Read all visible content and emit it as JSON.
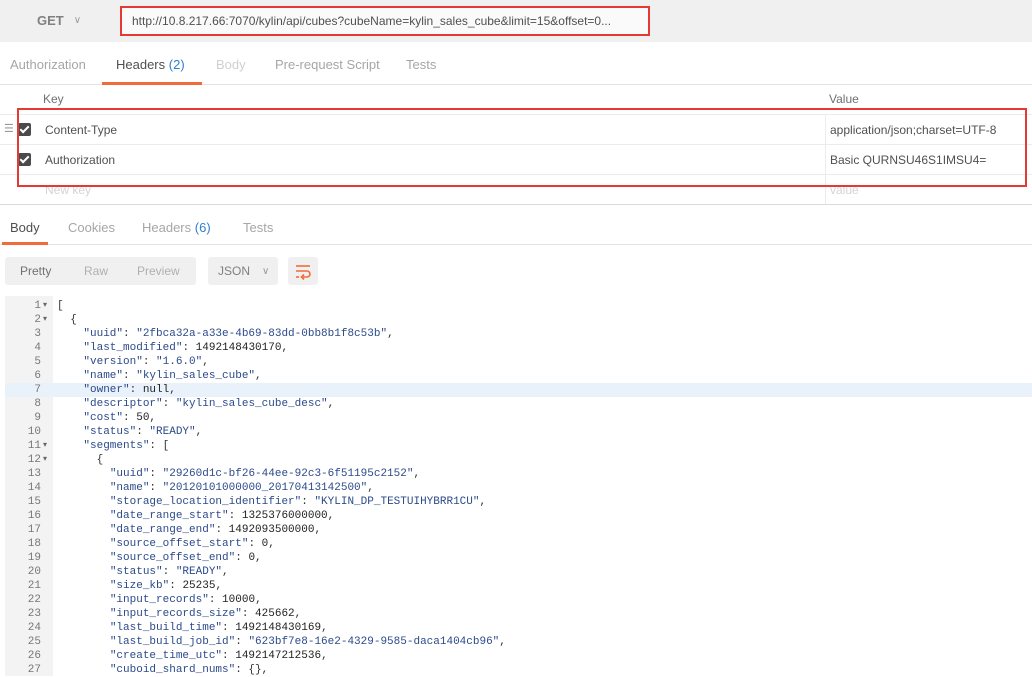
{
  "request": {
    "method": "GET",
    "url": "http://10.8.217.66:7070/kylin/api/cubes?cubeName=kylin_sales_cube&limit=15&offset=0..."
  },
  "request_tabs": [
    {
      "label": "Authorization"
    },
    {
      "label": "Headers",
      "count": "(2)"
    },
    {
      "label": "Body"
    },
    {
      "label": "Pre-request Script"
    },
    {
      "label": "Tests"
    }
  ],
  "headers_table": {
    "key_col": "Key",
    "value_col": "Value",
    "rows": [
      {
        "key": "Content-Type",
        "value": "application/json;charset=UTF-8"
      },
      {
        "key": "Authorization",
        "value": "Basic QURNSU46S1IMSU4="
      }
    ],
    "new_key_placeholder": "New key",
    "new_value_placeholder": "value"
  },
  "response_tabs": [
    {
      "label": "Body"
    },
    {
      "label": "Cookies"
    },
    {
      "label": "Headers",
      "count": "(6)"
    },
    {
      "label": "Tests"
    }
  ],
  "body_toolbar": {
    "views": [
      "Pretty",
      "Raw",
      "Preview"
    ],
    "format": "JSON",
    "wrap_icon": "wrap-lines-icon"
  },
  "code_lines": [
    {
      "n": "1",
      "fold": "▾",
      "text": "["
    },
    {
      "n": "2",
      "fold": "▾",
      "text": "  {"
    },
    {
      "n": "3",
      "fold": "",
      "text": "    \"uuid\": \"2fbca32a-a33e-4b69-83dd-0bb8b1f8c53b\","
    },
    {
      "n": "4",
      "fold": "",
      "text": "    \"last_modified\": 1492148430170,"
    },
    {
      "n": "5",
      "fold": "",
      "text": "    \"version\": \"1.6.0\","
    },
    {
      "n": "6",
      "fold": "",
      "text": "    \"name\": \"kylin_sales_cube\","
    },
    {
      "n": "7",
      "fold": "",
      "text": "    \"owner\": null,"
    },
    {
      "n": "8",
      "fold": "",
      "text": "    \"descriptor\": \"kylin_sales_cube_desc\","
    },
    {
      "n": "9",
      "fold": "",
      "text": "    \"cost\": 50,"
    },
    {
      "n": "10",
      "fold": "",
      "text": "    \"status\": \"READY\","
    },
    {
      "n": "11",
      "fold": "▾",
      "text": "    \"segments\": ["
    },
    {
      "n": "12",
      "fold": "▾",
      "text": "      {"
    },
    {
      "n": "13",
      "fold": "",
      "text": "        \"uuid\": \"29260d1c-bf26-44ee-92c3-6f51195c2152\","
    },
    {
      "n": "14",
      "fold": "",
      "text": "        \"name\": \"20120101000000_20170413142500\","
    },
    {
      "n": "15",
      "fold": "",
      "text": "        \"storage_location_identifier\": \"KYLIN_DP_TESTUIHYBRR1CU\","
    },
    {
      "n": "16",
      "fold": "",
      "text": "        \"date_range_start\": 1325376000000,"
    },
    {
      "n": "17",
      "fold": "",
      "text": "        \"date_range_end\": 1492093500000,"
    },
    {
      "n": "18",
      "fold": "",
      "text": "        \"source_offset_start\": 0,"
    },
    {
      "n": "19",
      "fold": "",
      "text": "        \"source_offset_end\": 0,"
    },
    {
      "n": "20",
      "fold": "",
      "text": "        \"status\": \"READY\","
    },
    {
      "n": "21",
      "fold": "",
      "text": "        \"size_kb\": 25235,"
    },
    {
      "n": "22",
      "fold": "",
      "text": "        \"input_records\": 10000,"
    },
    {
      "n": "23",
      "fold": "",
      "text": "        \"input_records_size\": 425662,"
    },
    {
      "n": "24",
      "fold": "",
      "text": "        \"last_build_time\": 1492148430169,"
    },
    {
      "n": "25",
      "fold": "",
      "text": "        \"last_build_job_id\": \"623bf7e8-16e2-4329-9585-daca1404cb96\","
    },
    {
      "n": "26",
      "fold": "",
      "text": "        \"create_time_utc\": 1492147212536,"
    },
    {
      "n": "27",
      "fold": "",
      "text": "        \"cuboid_shard_nums\": {},"
    }
  ],
  "highlighted_line": "7"
}
